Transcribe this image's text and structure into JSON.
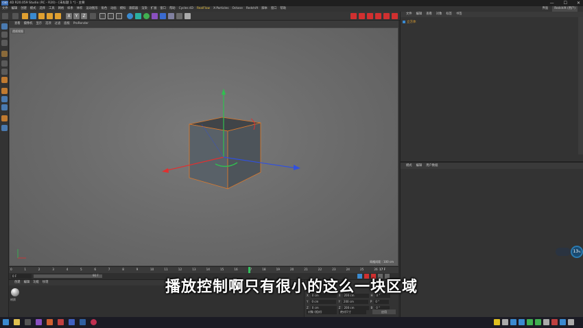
{
  "window": {
    "title": "4D R20.059 Studio (RC - R20) - [未标题 1 *] - 主要",
    "logo_text": "C4D",
    "controls": [
      "—",
      "☐",
      "✕"
    ]
  },
  "menubar": {
    "items": [
      "文件",
      "编辑",
      "创建",
      "模式",
      "选择",
      "工具",
      "网格",
      "样条",
      "体积",
      "运动图形",
      "角色",
      "动画",
      "模拟",
      "跟踪器",
      "渲染",
      "扩展",
      "窗口",
      "帮助"
    ],
    "center_items": [
      "Cycles 4D",
      "RealFlow",
      "X-Particles",
      "Octane",
      "Redshift",
      "脚本",
      "窗口",
      "帮助"
    ],
    "right_label": "界面",
    "layout_value": "Redshift (用户)"
  },
  "viewport": {
    "menu": [
      "查看",
      "摄像机",
      "显示",
      "选项",
      "过滤",
      "面板",
      "ProRender"
    ],
    "label": "透视视图",
    "grid_spacing": "网格间距 : 100 cm"
  },
  "timeline": {
    "ticks": [
      "0",
      "1",
      "2",
      "3",
      "4",
      "5",
      "6",
      "7",
      "8",
      "9",
      "10",
      "11",
      "12",
      "13",
      "14",
      "15",
      "16",
      "17",
      "18",
      "19",
      "20",
      "21",
      "22",
      "23",
      "24",
      "25",
      "26"
    ],
    "current_frame": "17 F",
    "start_field": "0 F",
    "end_field": "90 F"
  },
  "material_panel": {
    "menu": [
      "创建",
      "编辑",
      "功能",
      "纹理"
    ],
    "material_name": "材质"
  },
  "coords": {
    "rows": [
      {
        "axis": "X",
        "pos": "0 cm",
        "size_axis": "X",
        "size": "200 cm",
        "rot_axis": "H",
        "rot": "0 °"
      },
      {
        "axis": "Y",
        "pos": "0 cm",
        "size_axis": "Y",
        "size": "200 cm",
        "rot_axis": "P",
        "rot": "0 °"
      },
      {
        "axis": "Z",
        "pos": "0 cm",
        "size_axis": "Z",
        "size": "200 cm",
        "rot_axis": "B",
        "rot": "0 °"
      }
    ],
    "mode_object": "对象 (相对)",
    "mode_size": "绝对尺寸",
    "apply": "应用"
  },
  "object_panel": {
    "menu": [
      "文件",
      "编辑",
      "查看",
      "对象",
      "标签",
      "书签"
    ],
    "object_name": "立方体"
  },
  "attr_panel": {
    "menu": [
      "模式",
      "编辑",
      "用户数据"
    ]
  },
  "net_widget": {
    "value": "13",
    "unit": "%"
  },
  "subtitle": "播放控制啊只有很小的这么一块区域",
  "colors": {
    "accent_red": "#d03030",
    "playhead_green": "#36c060",
    "axis_x": "#e03030",
    "axis_y": "#30c050",
    "axis_z": "#3050e0",
    "selection_orange": "#e07a2a"
  }
}
